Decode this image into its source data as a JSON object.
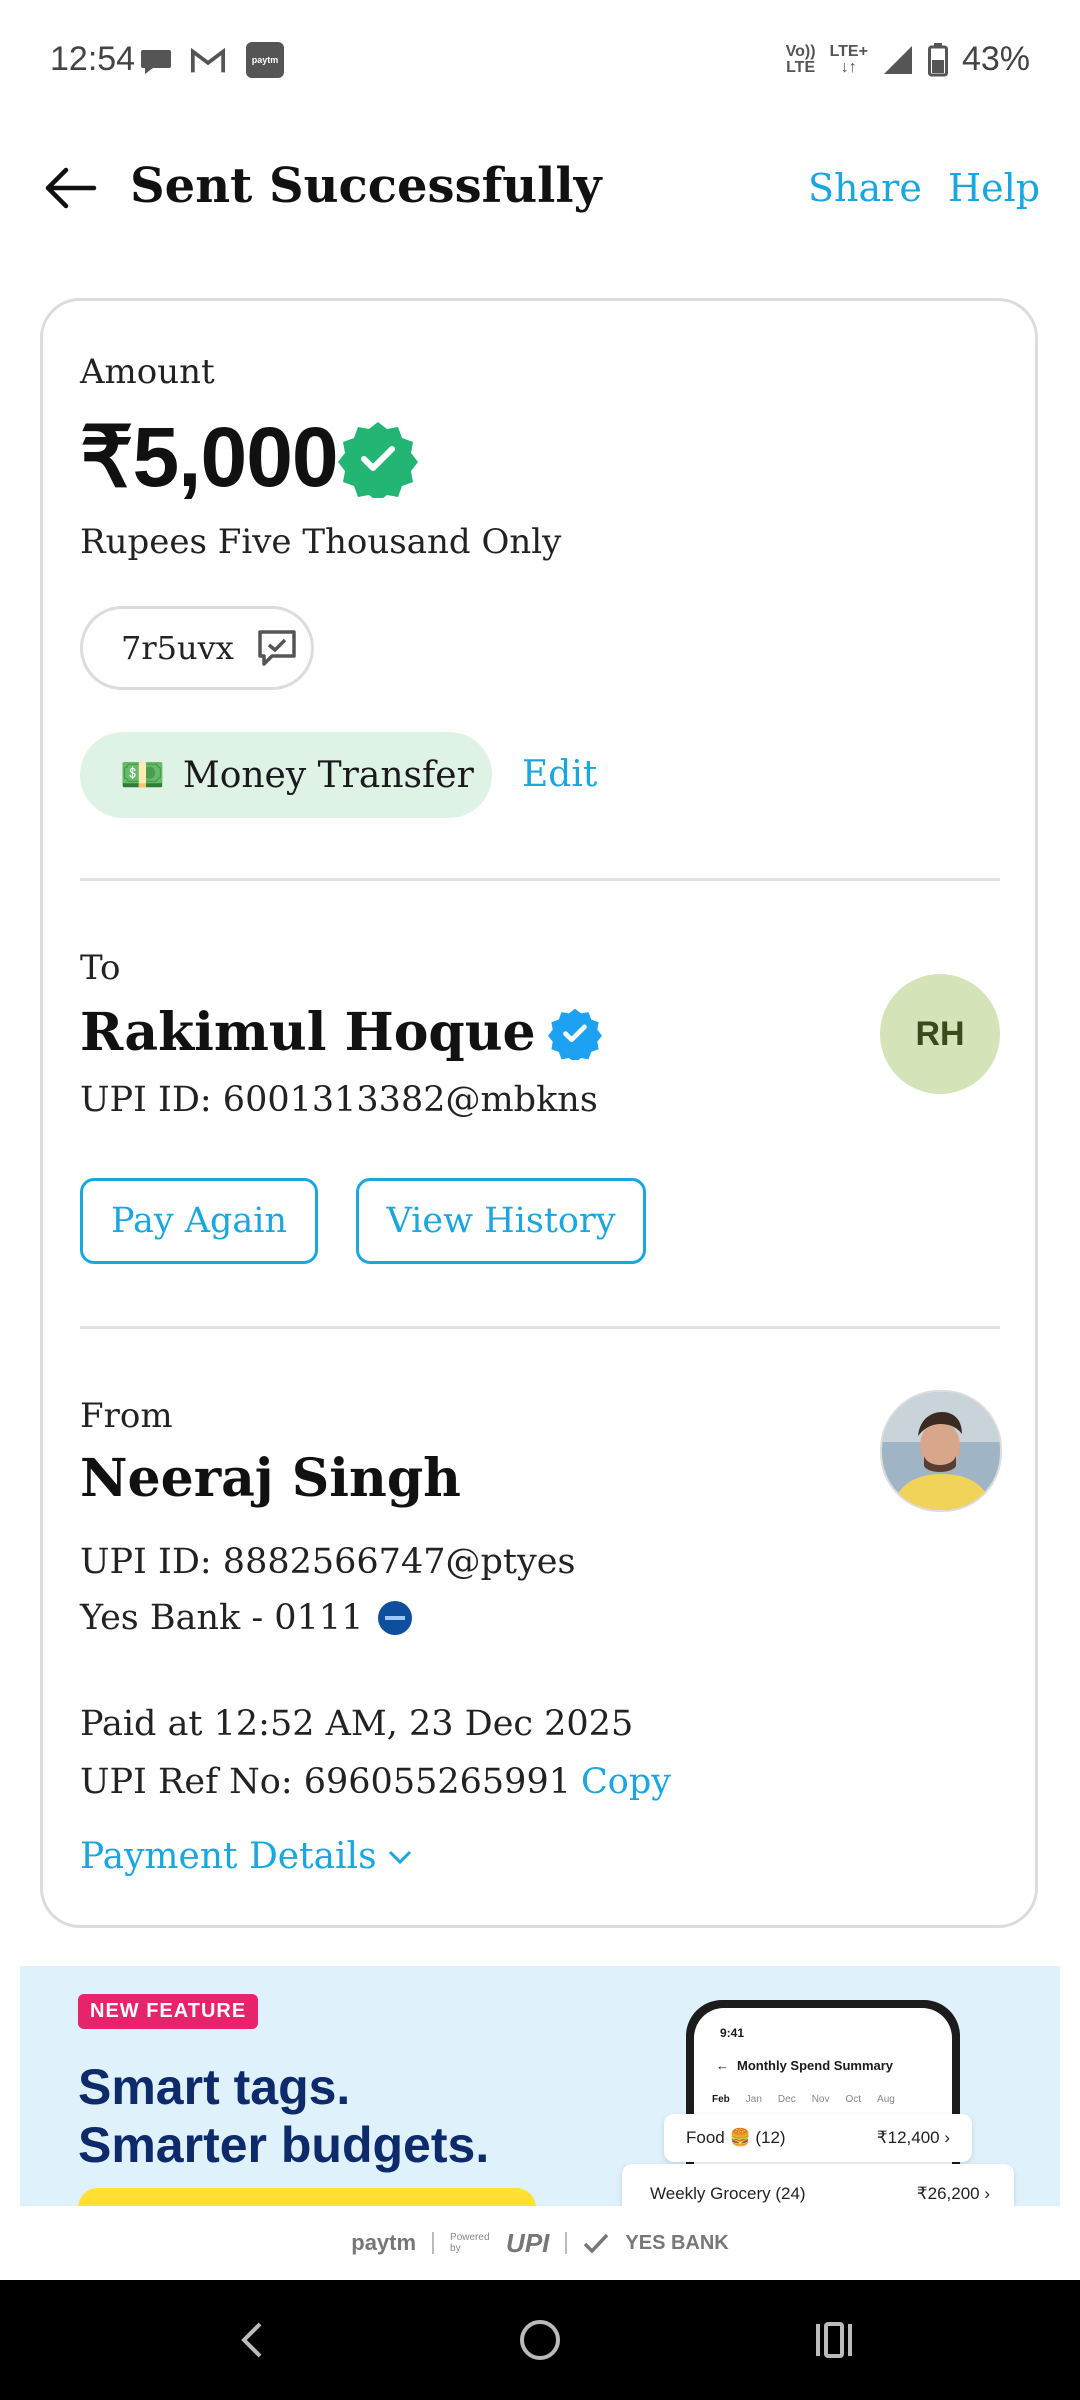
{
  "status": {
    "time": "12:54",
    "battery": "43%",
    "net_top": "Vo))",
    "net_bottom": "LTE",
    "lte_top": "LTE+",
    "lte_bottom": "↓↑",
    "paytm_badge": "paytm"
  },
  "header": {
    "title": "Sent Successfully",
    "share": "Share",
    "help": "Help"
  },
  "amount": {
    "label": "Amount",
    "value": "₹5,000",
    "words": "Rupees Five Thousand Only",
    "note": "7r5uvx",
    "category_emoji": "💵",
    "category": "Money Transfer",
    "edit": "Edit"
  },
  "to": {
    "label": "To",
    "name": "Rakimul Hoque",
    "upi": "UPI ID: 6001313382@mbkns",
    "initials": "RH",
    "pay_again": "Pay Again",
    "view_history": "View History"
  },
  "from": {
    "label": "From",
    "name": "Neeraj Singh",
    "upi": "UPI ID: 8882566747@ptyes",
    "bank": "Yes Bank - 0111",
    "paid_at": "Paid at 12:52 AM, 23 Dec 2025",
    "ref": "UPI Ref No: 696055265991",
    "copy": "Copy",
    "payment_details": "Payment Details"
  },
  "banner": {
    "badge": "NEW FEATURE",
    "line1": "Smart tags.",
    "line2": "Smarter budgets.",
    "phone_time": "9:41",
    "phone_title": "Monthly Spend Summary",
    "tabs": [
      "Feb",
      "Jan",
      "Dec",
      "Nov",
      "Oct",
      "Aug"
    ],
    "row1_label": "Food 🍔 (12)",
    "row1_value": "₹12,400",
    "row2_label": "Weekly Grocery (24)",
    "row2_value": "₹26,200"
  },
  "footer": {
    "paytm": "paytm",
    "powered": "Powered by",
    "upi": "UPI",
    "yesbank": "YES BANK"
  },
  "colors": {
    "accent": "#1aa6df",
    "success": "#22b573",
    "verified": "#1da1f2",
    "category_bg": "#dff2e6"
  }
}
